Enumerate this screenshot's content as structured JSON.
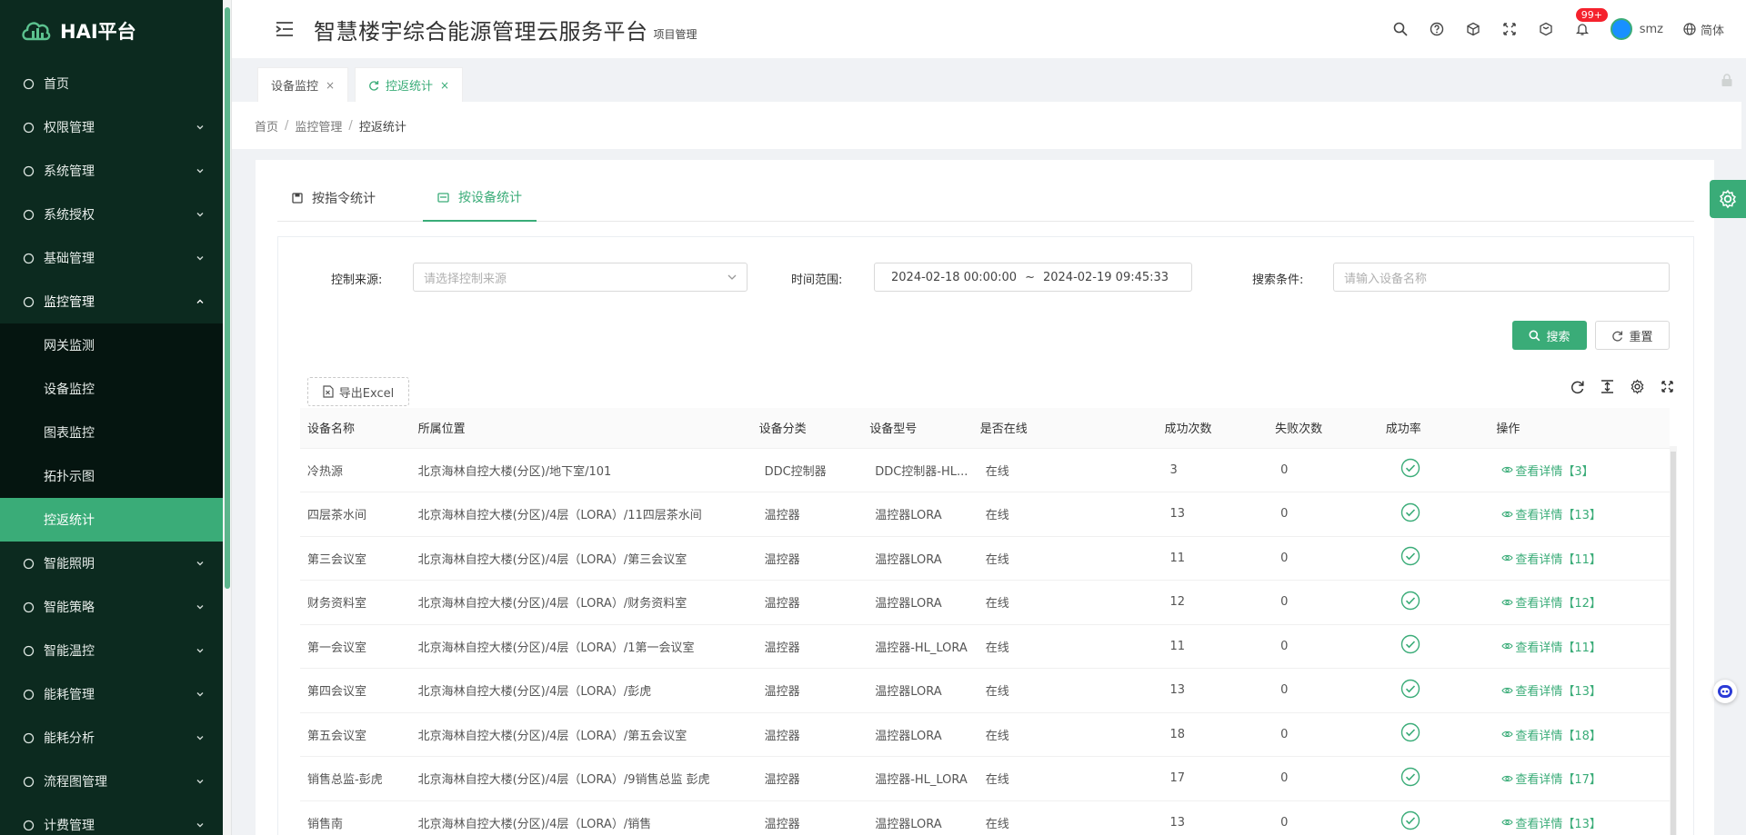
{
  "app": {
    "logo_text": "HAI平台",
    "title": "智慧楼宇综合能源管理云服务平台",
    "subtitle": "项目管理"
  },
  "header": {
    "badge": "99+",
    "username": "smz",
    "lang": "简体"
  },
  "sidebar": {
    "items": [
      {
        "label": "首页",
        "icon": "dashboard-icon",
        "arrow": false
      },
      {
        "label": "权限管理",
        "icon": "shield-icon",
        "arrow": true
      },
      {
        "label": "系统管理",
        "icon": "monitor-icon",
        "arrow": true
      },
      {
        "label": "系统授权",
        "icon": "key-icon",
        "arrow": true
      },
      {
        "label": "基础管理",
        "icon": "database-icon",
        "arrow": true
      },
      {
        "label": "监控管理",
        "icon": "monitor-chart-icon",
        "arrow": true,
        "open": true
      }
    ],
    "sub_items": [
      {
        "label": "网关监测"
      },
      {
        "label": "设备监控"
      },
      {
        "label": "图表监控"
      },
      {
        "label": "拓扑示图"
      },
      {
        "label": "控返统计",
        "active": true
      }
    ],
    "items_after": [
      {
        "label": "智能照明",
        "icon": "bulb-icon"
      },
      {
        "label": "智能策略",
        "icon": "pin-icon"
      },
      {
        "label": "智能温控",
        "icon": "thermo-icon"
      },
      {
        "label": "能耗管理",
        "icon": "sliders-icon"
      },
      {
        "label": "能耗分析",
        "icon": "bar-chart-icon"
      },
      {
        "label": "流程图管理",
        "icon": "flow-icon"
      },
      {
        "label": "计费管理",
        "icon": "bill-icon"
      }
    ]
  },
  "tabs": [
    {
      "label": "设备监控",
      "close": "×"
    },
    {
      "label": "控返统计",
      "close": "×"
    }
  ],
  "breadcrumb": {
    "home": "首页",
    "parent": "监控管理",
    "current": "控返统计",
    "sep": "/"
  },
  "content_tabs": {
    "by_command": "按指令统计",
    "by_device": "按设备统计"
  },
  "filters": {
    "source_label": "控制来源:",
    "source_placeholder": "请选择控制来源",
    "time_label": "时间范围:",
    "time_start": "2024-02-18 00:00:00",
    "time_sep": "~",
    "time_end": "2024-02-19 09:45:33",
    "search_label": "搜索条件:",
    "search_placeholder": "请输入设备名称"
  },
  "buttons": {
    "search": "搜索",
    "reset": "重置",
    "export": "导出Excel"
  },
  "table": {
    "headers": [
      "设备名称",
      "所属位置",
      "设备分类",
      "设备型号",
      "是否在线",
      "成功次数",
      "失败次数",
      "成功率",
      "操作"
    ],
    "rows": [
      {
        "name": "冷热源",
        "location": "北京海林自控大楼(分区)/地下室/101",
        "category": "DDC控制器",
        "model": "DDC控制器-HL...",
        "online": "在线",
        "success": "3",
        "fail": "0",
        "action": "查看详情【3】"
      },
      {
        "name": "四层茶水间",
        "location": "北京海林自控大楼(分区)/4层（LORA）/11四层茶水间",
        "category": "温控器",
        "model": "温控器LORA",
        "online": "在线",
        "success": "13",
        "fail": "0",
        "action": "查看详情【13】"
      },
      {
        "name": "第三会议室",
        "location": "北京海林自控大楼(分区)/4层（LORA）/第三会议室",
        "category": "温控器",
        "model": "温控器LORA",
        "online": "在线",
        "success": "11",
        "fail": "0",
        "action": "查看详情【11】"
      },
      {
        "name": "财务资料室",
        "location": "北京海林自控大楼(分区)/4层（LORA）/财务资料室",
        "category": "温控器",
        "model": "温控器LORA",
        "online": "在线",
        "success": "12",
        "fail": "0",
        "action": "查看详情【12】"
      },
      {
        "name": "第一会议室",
        "location": "北京海林自控大楼(分区)/4层（LORA）/1第一会议室",
        "category": "温控器",
        "model": "温控器-HL_LORA",
        "online": "在线",
        "success": "11",
        "fail": "0",
        "action": "查看详情【11】"
      },
      {
        "name": "第四会议室",
        "location": "北京海林自控大楼(分区)/4层（LORA）/彭虎",
        "category": "温控器",
        "model": "温控器LORA",
        "online": "在线",
        "success": "13",
        "fail": "0",
        "action": "查看详情【13】"
      },
      {
        "name": "第五会议室",
        "location": "北京海林自控大楼(分区)/4层（LORA）/第五会议室",
        "category": "温控器",
        "model": "温控器LORA",
        "online": "在线",
        "success": "18",
        "fail": "0",
        "action": "查看详情【18】"
      },
      {
        "name": "销售总监-彭虎",
        "location": "北京海林自控大楼(分区)/4层（LORA）/9销售总监 彭虎",
        "category": "温控器",
        "model": "温控器-HL_LORA",
        "online": "在线",
        "success": "17",
        "fail": "0",
        "action": "查看详情【17】"
      },
      {
        "name": "销售南",
        "location": "北京海林自控大楼(分区)/4层（LORA）/销售",
        "category": "温控器",
        "model": "温控器LORA",
        "online": "在线",
        "success": "13",
        "fail": "0",
        "action": "查看详情【13】"
      }
    ]
  },
  "colors": {
    "primary": "#3aac78",
    "sidebar_bg": "#0c2a1f",
    "sidebar_sub_bg": "#051510"
  }
}
